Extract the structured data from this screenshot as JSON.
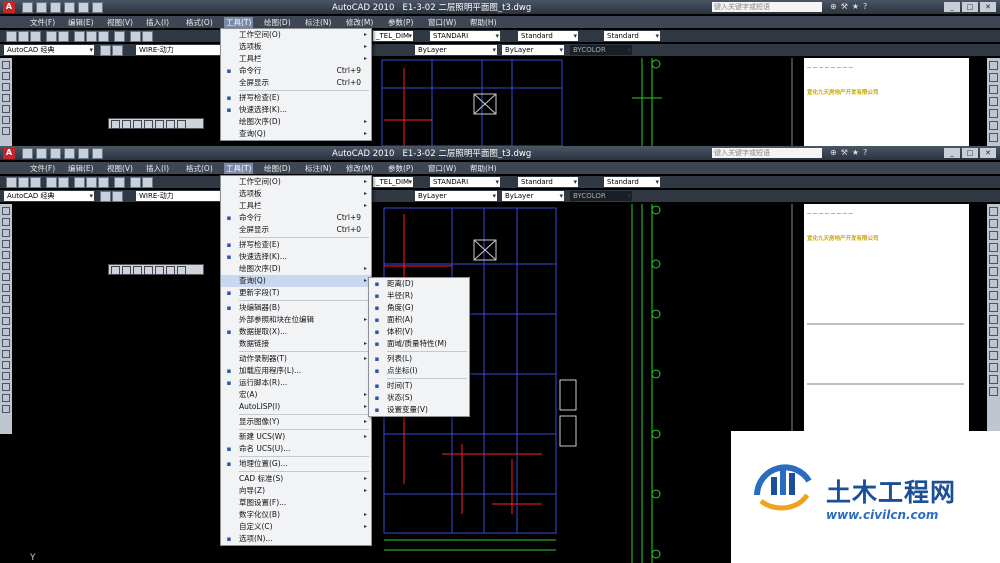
{
  "app": {
    "title": "AutoCAD 2010",
    "document": "E1-3-02 二层照明平面图_t3.dwg",
    "search_placeholder": "键入关键字或短语"
  },
  "menubar": [
    "文件(F)",
    "编辑(E)",
    "视图(V)",
    "插入(I)",
    "格式(O)",
    "工具(T)",
    "绘图(D)",
    "标注(N)",
    "修改(M)",
    "参数(P)",
    "窗口(W)",
    "帮助(H)"
  ],
  "toolbars": {
    "workspace": "AutoCAD 经典",
    "layer": "WIRE-动力",
    "dimstyle": "_TEL_DIM",
    "textstyle": "STANDARI",
    "tablestyle": "Standard",
    "mleaderstyle": "Standard",
    "linetype": "ByLayer",
    "lineweight": "ByLayer",
    "plotstyle": "BYCOLOR"
  },
  "tools_menu_top": [
    {
      "label": "工作空间(O)",
      "arrow": true
    },
    {
      "label": "选项板",
      "arrow": true
    },
    {
      "label": "工具栏",
      "arrow": true
    },
    {
      "label": "命令行",
      "shortcut": "Ctrl+9",
      "icon": "command-line-icon"
    },
    {
      "label": "全屏显示",
      "shortcut": "Ctrl+0"
    },
    {
      "sep": true
    },
    {
      "label": "拼写检查(E)",
      "icon": "spell-check-icon"
    },
    {
      "label": "快速选择(K)...",
      "icon": "quick-select-icon"
    },
    {
      "label": "绘图次序(D)",
      "arrow": true
    },
    {
      "label": "查询(Q)",
      "arrow": true
    }
  ],
  "tools_menu": [
    {
      "label": "工作空间(O)",
      "arrow": true
    },
    {
      "label": "选项板",
      "arrow": true
    },
    {
      "label": "工具栏",
      "arrow": true
    },
    {
      "label": "命令行",
      "shortcut": "Ctrl+9",
      "icon": "command-line-icon"
    },
    {
      "label": "全屏显示",
      "shortcut": "Ctrl+0"
    },
    {
      "sep": true
    },
    {
      "label": "拼写检查(E)",
      "icon": "spell-check-icon"
    },
    {
      "label": "快速选择(K)...",
      "icon": "quick-select-icon"
    },
    {
      "label": "绘图次序(D)",
      "arrow": true
    },
    {
      "label": "查询(Q)",
      "arrow": true,
      "active": true
    },
    {
      "label": "更新字段(T)",
      "icon": "update-field-icon"
    },
    {
      "sep": true
    },
    {
      "label": "块编辑器(B)",
      "icon": "block-editor-icon"
    },
    {
      "label": "外部参照和块在位编辑",
      "arrow": true
    },
    {
      "label": "数据提取(X)...",
      "icon": "data-extraction-icon"
    },
    {
      "label": "数据链接",
      "arrow": true
    },
    {
      "sep": true
    },
    {
      "label": "动作录制器(T)",
      "arrow": true
    },
    {
      "label": "加载应用程序(L)...",
      "icon": "load-app-icon"
    },
    {
      "label": "运行脚本(R)...",
      "icon": "run-script-icon"
    },
    {
      "label": "宏(A)",
      "arrow": true
    },
    {
      "label": "AutoLISP(I)",
      "arrow": true
    },
    {
      "sep": true
    },
    {
      "label": "显示图像(Y)",
      "arrow": true
    },
    {
      "sep": true
    },
    {
      "label": "新建 UCS(W)",
      "arrow": true
    },
    {
      "label": "命名 UCS(U)...",
      "icon": "named-ucs-icon"
    },
    {
      "sep": true
    },
    {
      "label": "地理位置(G)...",
      "icon": "geo-location-icon"
    },
    {
      "sep": true
    },
    {
      "label": "CAD 标准(S)",
      "arrow": true
    },
    {
      "label": "向导(Z)",
      "arrow": true
    },
    {
      "label": "草图设置(F)..."
    },
    {
      "label": "数字化仪(B)",
      "arrow": true
    },
    {
      "label": "自定义(C)",
      "arrow": true
    },
    {
      "label": "选项(N)...",
      "icon": "options-icon"
    }
  ],
  "inquiry_submenu": [
    {
      "label": "距离(D)",
      "icon": "distance-icon"
    },
    {
      "label": "半径(R)",
      "icon": "radius-icon"
    },
    {
      "label": "角度(G)",
      "icon": "angle-icon"
    },
    {
      "label": "面积(A)",
      "icon": "area-icon"
    },
    {
      "label": "体积(V)",
      "icon": "volume-icon"
    },
    {
      "label": "面域/质量特性(M)",
      "icon": "mass-properties-icon"
    },
    {
      "sep": true
    },
    {
      "label": "列表(L)",
      "icon": "list-icon"
    },
    {
      "label": "点坐标(I)",
      "icon": "point-coordinate-icon"
    },
    {
      "sep": true
    },
    {
      "label": "时间(T)",
      "icon": "time-icon"
    },
    {
      "label": "状态(S)",
      "icon": "status-icon"
    },
    {
      "label": "设置变量(V)",
      "icon": "set-variable-icon"
    }
  ],
  "watermark": {
    "brand": "土木工程网",
    "url": "www.civilcn.com"
  },
  "sheet_text": {
    "company": "宣化九天房地产开发有限公司"
  },
  "colors": {
    "menu_bg": "#f2f3f5",
    "highlight": "#c8d8ee",
    "brand": "#1b4f96"
  }
}
